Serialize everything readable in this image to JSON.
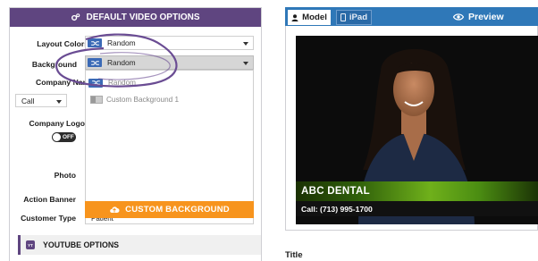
{
  "left_panel": {
    "header": "DEFAULT VIDEO OPTIONS",
    "fields": {
      "layout_colors": {
        "label": "Layout Colors",
        "value": "Random"
      },
      "background": {
        "label": "Background",
        "value": "Random"
      },
      "company_name": {
        "label": "Company Name"
      },
      "call": {
        "value": "Call"
      },
      "company_logo": {
        "label": "Company Logo",
        "toggle": "OFF"
      },
      "photo": {
        "label": "Photo"
      },
      "action_banner": {
        "label": "Action Banner"
      },
      "customer_type": {
        "label": "Customer Type",
        "value": "Patient"
      }
    },
    "background_options": [
      {
        "label": "Random",
        "icon": "shuffle-icon"
      },
      {
        "label": "Custom Background 1",
        "icon": "image-thumbnail-icon"
      }
    ],
    "custom_background_button": "CUSTOM BACKGROUND",
    "youtube_section": "YOUTUBE OPTIONS"
  },
  "right_panel": {
    "tabs": [
      {
        "label": "Model",
        "icon": "person-icon",
        "active": true
      },
      {
        "label": "iPad",
        "icon": "tablet-icon",
        "active": false
      }
    ],
    "preview_label": "Preview",
    "video_overlay": {
      "business_name": "ABC DENTAL",
      "phone": "Call: (713) 995-1700"
    },
    "title_label": "Title"
  },
  "colors": {
    "header_purple": "#5f4580",
    "tab_blue": "#2f78b8",
    "orange": "#f7941d",
    "shuffle_blue": "#3b6ab6",
    "annotation_purple": "#6a4c93"
  }
}
